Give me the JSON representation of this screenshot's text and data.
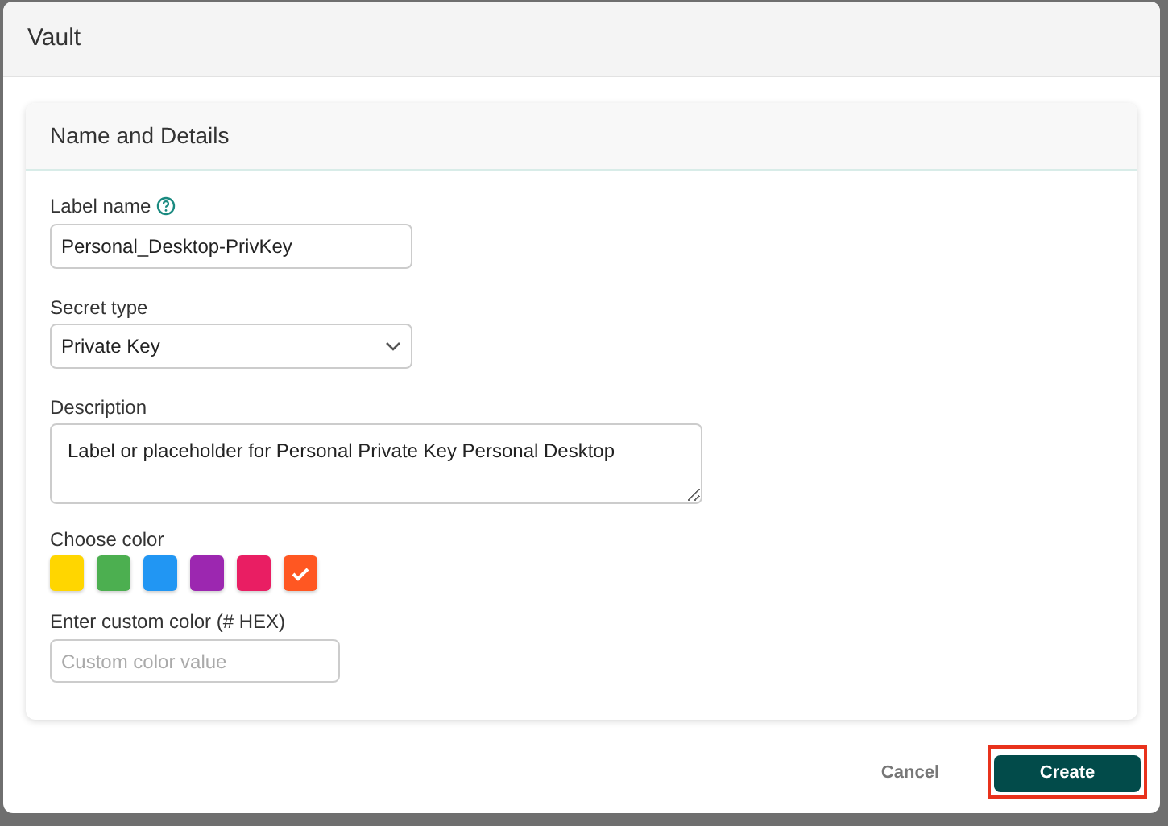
{
  "window": {
    "title": "Vault"
  },
  "section": {
    "title": "Name and Details"
  },
  "label_name": {
    "label": "Label name",
    "value": "Personal_Desktop-PrivKey"
  },
  "secret_type": {
    "label": "Secret type",
    "value": "Private Key"
  },
  "description": {
    "label": "Description",
    "value": "Label or placeholder for Personal Private Key Personal Desktop"
  },
  "choose_color": {
    "label": "Choose color",
    "swatches": [
      {
        "color": "#ffd600",
        "selected": false
      },
      {
        "color": "#4caf50",
        "selected": false
      },
      {
        "color": "#2196f3",
        "selected": false
      },
      {
        "color": "#9c27b0",
        "selected": false
      },
      {
        "color": "#e91e63",
        "selected": false
      },
      {
        "color": "#ff5722",
        "selected": true
      }
    ]
  },
  "custom_color": {
    "label": "Enter custom color (# HEX)",
    "placeholder": "Custom color value"
  },
  "buttons": [
    {
      "kind": "secondary",
      "label": "Cancel",
      "highlighted": false
    },
    {
      "kind": "primary",
      "label": "Create",
      "highlighted": true
    }
  ]
}
